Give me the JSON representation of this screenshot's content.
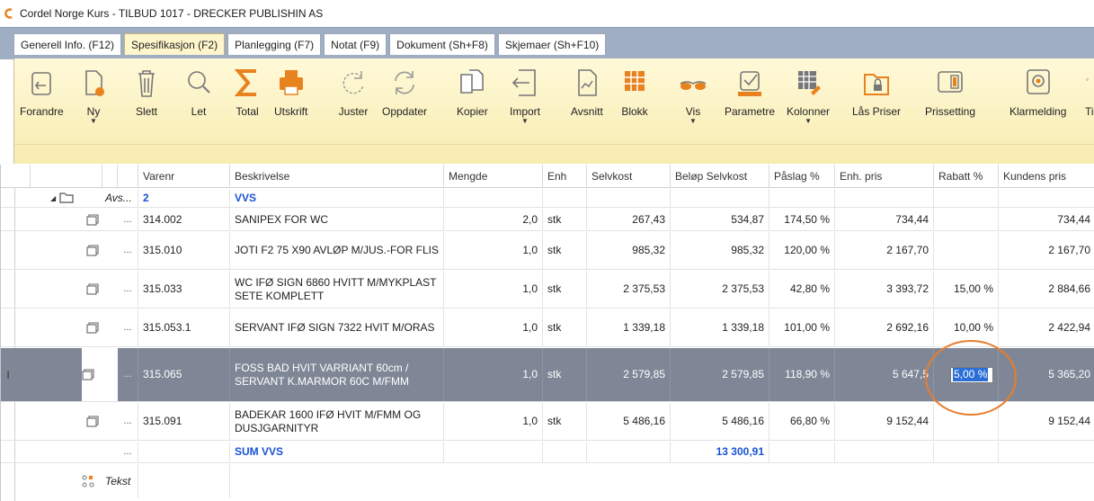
{
  "window": {
    "title": "Cordel Norge Kurs - TILBUD 1017 - DRECKER PUBLISHIN AS"
  },
  "tabs": [
    {
      "label": "Generell Info. (F12)",
      "active": false
    },
    {
      "label": "Spesifikasjon (F2)",
      "active": true
    },
    {
      "label": "Planlegging (F7)",
      "active": false
    },
    {
      "label": "Notat (F9)",
      "active": false
    },
    {
      "label": "Dokument (Sh+F8)",
      "active": false
    },
    {
      "label": "Skjemaer (Sh+F10)",
      "active": false
    }
  ],
  "ribbon": {
    "forandre": "Forandre",
    "ny": "Ny",
    "slett": "Slett",
    "let": "Let",
    "total": "Total",
    "utskrift": "Utskrift",
    "juster": "Juster",
    "oppdater": "Oppdater",
    "kopier": "Kopier",
    "import": "Import",
    "avsnitt": "Avsnitt",
    "blokk": "Blokk",
    "vis": "Vis",
    "parametre": "Parametre",
    "kolonner": "Kolonner",
    "las_priser": "Lås Priser",
    "prissetting": "Prissetting",
    "klarmelding": "Klarmelding",
    "ti": "Ti"
  },
  "grid": {
    "headers": {
      "varenr": "Varenr",
      "beskrivelse": "Beskrivelse",
      "mengde": "Mengde",
      "enh": "Enh",
      "selvkost": "Selvkost",
      "belop_selvkost": "Beløp Selvkost",
      "paslag": "Påslag %",
      "enh_pris": "Enh. pris",
      "rabatt": "Rabatt %",
      "kundens_pris": "Kundens pris"
    },
    "group": {
      "type": "Avs...",
      "number": "2",
      "title": "VVS"
    },
    "rows": [
      {
        "varenr": "314.002",
        "beskrivelse": "SANIPEX FOR WC",
        "mengde": "2,0",
        "enh": "stk",
        "selvkost": "267,43",
        "belop": "534,87",
        "paslag": "174,50 %",
        "enhpris": "734,44",
        "rabatt": "",
        "kundenspris": "734,44"
      },
      {
        "varenr": "315.010",
        "beskrivelse": "JOTI F2 75 X90 AVLØP M/JUS.-FOR FLIS",
        "mengde": "1,0",
        "enh": "stk",
        "selvkost": "985,32",
        "belop": "985,32",
        "paslag": "120,00 %",
        "enhpris": "2 167,70",
        "rabatt": "",
        "kundenspris": "2 167,70"
      },
      {
        "varenr": "315.033",
        "beskrivelse": "WC IFØ SIGN 6860 HVITT M/MYKPLAST SETE KOMPLETT",
        "mengde": "1,0",
        "enh": "stk",
        "selvkost": "2 375,53",
        "belop": "2 375,53",
        "paslag": "42,80 %",
        "enhpris": "3 393,72",
        "rabatt": "15,00 %",
        "kundenspris": "2 884,66"
      },
      {
        "varenr": "315.053.1",
        "beskrivelse": "SERVANT IFØ SIGN 7322 HVIT M/ORAS",
        "mengde": "1,0",
        "enh": "stk",
        "selvkost": "1 339,18",
        "belop": "1 339,18",
        "paslag": "101,00 %",
        "enhpris": "2 692,16",
        "rabatt": "10,00 %",
        "kundenspris": "2 422,94"
      },
      {
        "varenr": "315.065",
        "beskrivelse": "FOSS BAD HVIT VARRIANT 60cm / SERVANT K.MARMOR 60C M/FMM",
        "mengde": "1,0",
        "enh": "stk",
        "selvkost": "2 579,85",
        "belop": "2 579,85",
        "paslag": "118,90 %",
        "enhpris": "5 647,5",
        "rabatt": "5,00 %",
        "kundenspris": "5 365,20"
      },
      {
        "varenr": "315.091",
        "beskrivelse": "BADEKAR 1600 IFØ HVIT M/FMM OG DUSJGARNITYR",
        "mengde": "1,0",
        "enh": "stk",
        "selvkost": "5 486,16",
        "belop": "5 486,16",
        "paslag": "66,80 %",
        "enhpris": "9 152,44",
        "rabatt": "",
        "kundenspris": "9 152,44"
      }
    ],
    "dots": "...",
    "sum": {
      "label": "SUM VVS",
      "value": "13 300,91"
    },
    "text_row": {
      "label": "Tekst"
    },
    "row_indicator": "I"
  },
  "colors": {
    "selected_row": "#7f8796",
    "accent_blue": "#1a52d6",
    "annotation": "#e87d2c",
    "ribbon_icon": "#e8821e"
  }
}
